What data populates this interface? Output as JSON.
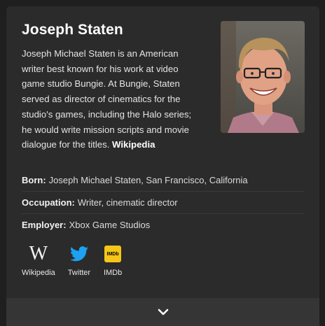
{
  "entity": {
    "name": "Joseph Staten",
    "description": "Joseph Michael Staten is an American writer best known for his work at video game studio Bungie. At Bungie, Staten served as director of cinematics for the studio's games, including the Halo series; he would write mission scripts and movie dialogue for the titles.",
    "source_link": "Wikipedia"
  },
  "facts": [
    {
      "label": "Born:",
      "value": "Joseph Michael Staten, San Francisco, California"
    },
    {
      "label": "Occupation:",
      "value": "Writer, cinematic director"
    },
    {
      "label": "Employer:",
      "value": "Xbox Game Studios"
    }
  ],
  "links": [
    {
      "label": "Wikipedia",
      "icon": "wikipedia-icon"
    },
    {
      "label": "Twitter",
      "icon": "twitter-icon",
      "color": "#1da1f2"
    },
    {
      "label": "IMDb",
      "icon": "imdb-icon",
      "color": "#f5c518",
      "badge": "IMDb"
    }
  ],
  "expand": {
    "icon": "chevron-down-icon"
  }
}
